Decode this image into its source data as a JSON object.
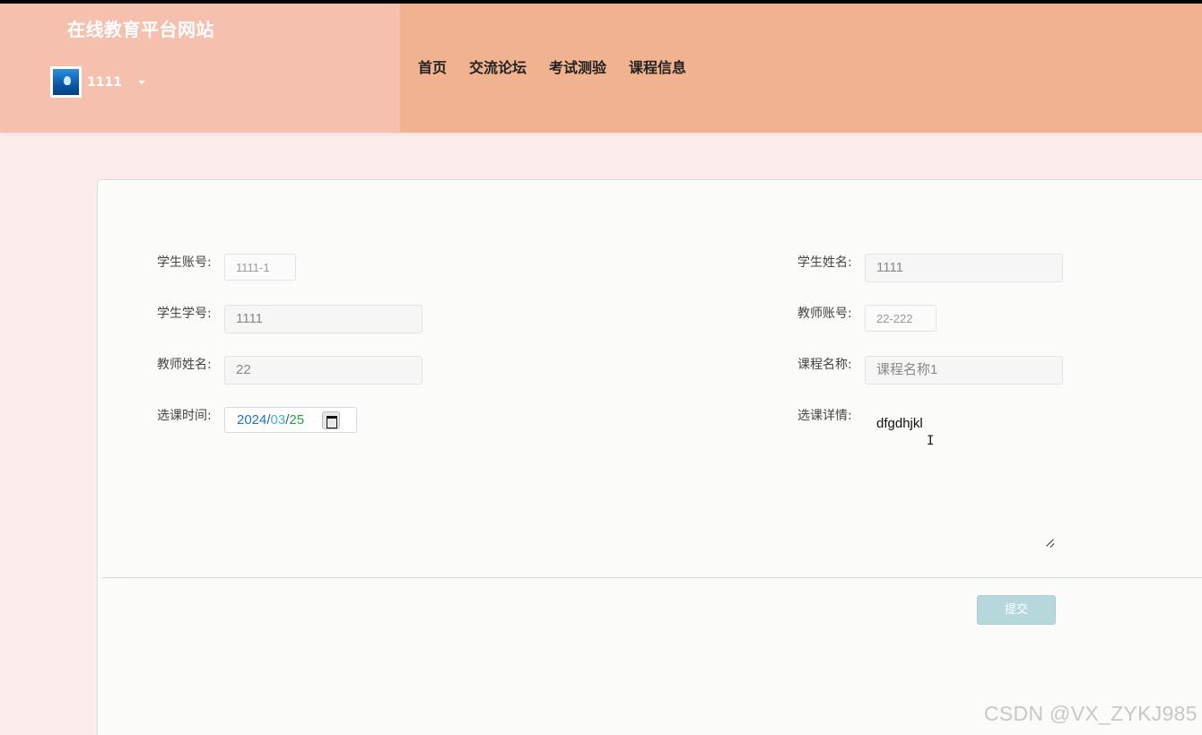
{
  "header": {
    "site_title": "在线教育平台网站",
    "user_name": "1111",
    "nav": [
      "首页",
      "交流论坛",
      "考试测验",
      "课程信息"
    ]
  },
  "form": {
    "student_account": {
      "label": "学生账号:",
      "value": "1111-1"
    },
    "student_name": {
      "label": "学生姓名:",
      "value": "1111"
    },
    "student_number": {
      "label": "学生学号:",
      "value": "1111"
    },
    "teacher_account": {
      "label": "教师账号:",
      "value": "22-222"
    },
    "teacher_name": {
      "label": "教师姓名:",
      "value": "22"
    },
    "course_name": {
      "label": "课程名称:",
      "value": "课程名称1"
    },
    "select_time": {
      "label": "选课时间:",
      "year": "2024",
      "month": "03",
      "day": "25"
    },
    "select_detail": {
      "label": "选课详情:",
      "value": "dfgdhjkl"
    },
    "submit_label": "提交"
  },
  "watermark": "CSDN @VX_ZYKJ985",
  "colors": {
    "header_left": "#f5c0ae",
    "header_right": "#f1b290",
    "page_bg": "#fbeceb",
    "submit_bg": "#b6d7db"
  }
}
